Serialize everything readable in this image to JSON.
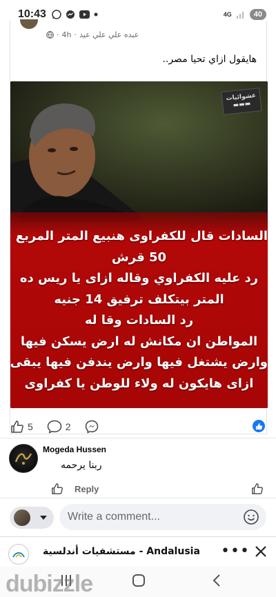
{
  "status_bar": {
    "time": "10:43",
    "network": "4G",
    "battery": "40"
  },
  "post": {
    "author": "عبده علي علي عيد",
    "age": "4h",
    "text": "هايقول ازاي تحيا مصر..",
    "image_watermark": "عشوائيات",
    "image_lines": [
      "السادات قال للكفراوى هنبيع المتر المربع ب",
      "50 قرش",
      "رد عليه الكفراوي وقاله ازاى يا ريس ده",
      "المتر بيتكلف ترفيق 14 جنيه",
      "رد السادات وقا له",
      "المواطن ان مكانش له ارض يسكن فيها",
      "وارض يشتغل فيها وارض يندفن فيها يبقى",
      "ازاى هايكون له ولاء للوطن يا كفراوى"
    ],
    "reactions": {
      "likes": "5",
      "comments": "2"
    }
  },
  "comment": {
    "name": "Mogeda Hussen",
    "text": "ربنا يرحمه",
    "reply_label": "Reply"
  },
  "composer": {
    "placeholder": "Write a comment..."
  },
  "ad": {
    "title": "مستشفيات أندلسية - Andalusia"
  },
  "watermark": {
    "brand": "dubizzle"
  },
  "colors": {
    "facebook_blue": "#1877f2",
    "panel_red": "#b30808"
  }
}
